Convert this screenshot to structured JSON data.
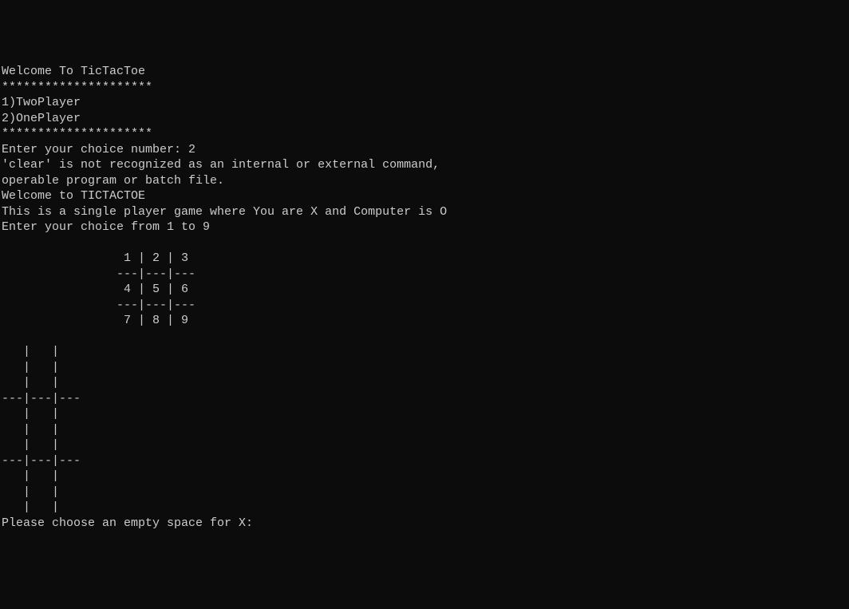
{
  "terminal": {
    "welcome_title": "Welcome To TicTacToe",
    "divider1": "*********************",
    "menu_opt1": "1)TwoPlayer",
    "menu_opt2": "2)OnePlayer",
    "divider2": "*********************",
    "prompt_choice_label": "Enter your choice number: ",
    "prompt_choice_value": "2",
    "error_line1": "'clear' is not recognized as an internal or external command,",
    "error_line2": "operable program or batch file.",
    "welcome_game": "Welcome to TICTACTOE",
    "game_desc": "This is a single player game where You are X and Computer is O",
    "choice_prompt": "Enter your choice from 1 to 9",
    "blank1": "",
    "ref_row1": "                 1 | 2 | 3",
    "ref_div1": "                ---|---|---",
    "ref_row2": "                 4 | 5 | 6",
    "ref_div2": "                ---|---|---",
    "ref_row3": "                 7 | 8 | 9",
    "blank2": "",
    "board_r1a": "   |   |  ",
    "board_r1b": "   |   |  ",
    "board_r1c": "   |   |  ",
    "board_d1": "---|---|---",
    "board_r2a": "   |   |  ",
    "board_r2b": "   |   |  ",
    "board_r2c": "   |   |  ",
    "board_d2": "---|---|---",
    "board_r3a": "   |   |  ",
    "board_r3b": "   |   |  ",
    "board_r3c": "   |   |  ",
    "move_prompt": "Please choose an empty space for X: "
  }
}
